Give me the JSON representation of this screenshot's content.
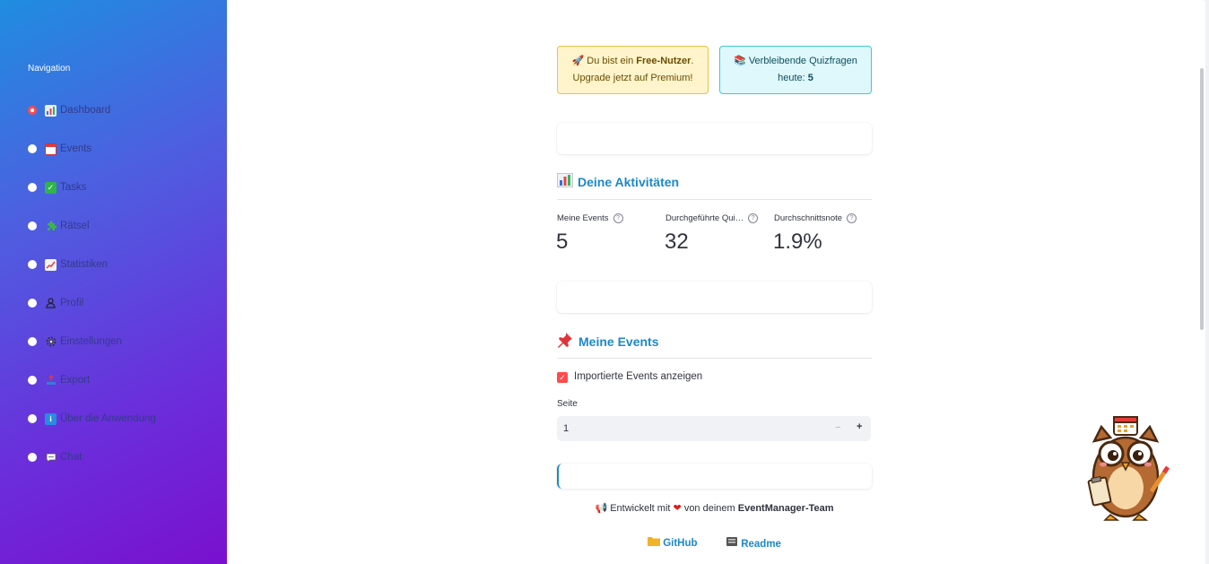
{
  "sidebar": {
    "title": "Navigation",
    "items": [
      {
        "label": "Dashboard",
        "icon": "bar-chart-icon",
        "selected": true
      },
      {
        "label": "Events",
        "icon": "calendar-icon",
        "selected": false
      },
      {
        "label": "Tasks",
        "icon": "checkmark-icon",
        "selected": false
      },
      {
        "label": "Rätsel",
        "icon": "puzzle-icon",
        "selected": false
      },
      {
        "label": "Statistiken",
        "icon": "trend-chart-icon",
        "selected": false
      },
      {
        "label": "Profil",
        "icon": "user-icon",
        "selected": false
      },
      {
        "label": "Einstellungen",
        "icon": "gear-icon",
        "selected": false
      },
      {
        "label": "Export",
        "icon": "upload-tray-icon",
        "selected": false
      },
      {
        "label": "Über die Anwendung",
        "icon": "info-icon",
        "selected": false
      },
      {
        "label": "Chat",
        "icon": "speech-bubble-icon",
        "selected": false
      }
    ]
  },
  "banners": {
    "free_prefix": "Du bist ein ",
    "free_bold": "Free-Nutzer",
    "free_suffix": ".",
    "free_line2": "Upgrade jetzt auf Premium!",
    "quiz_line1": "Verbleibende Quizfragen",
    "quiz_prefix": "heute: ",
    "quiz_count": "5"
  },
  "activities": {
    "title": "Deine Aktivitäten",
    "metrics": [
      {
        "label": "Meine Events",
        "value": "5"
      },
      {
        "label": "Durchgeführte Qui…",
        "value": "32"
      },
      {
        "label": "Durchschnittsnote",
        "value": "1.9%"
      }
    ]
  },
  "events": {
    "title": "Meine Events",
    "checkbox_label": "Importierte Events anzeigen",
    "checkbox_checked": true,
    "page_label": "Seite",
    "page_value": "1",
    "minus": "−",
    "plus": "+"
  },
  "footer": {
    "prefix": "Entwickelt mit",
    "middle": "von deinem",
    "team": "EventManager-Team",
    "github": "GitHub",
    "readme": "Readme"
  },
  "colors": {
    "accent": "#ff4b4b",
    "link": "#1e88c7",
    "sidebar_start": "#1f8de0",
    "sidebar_end": "#7a10cf"
  }
}
